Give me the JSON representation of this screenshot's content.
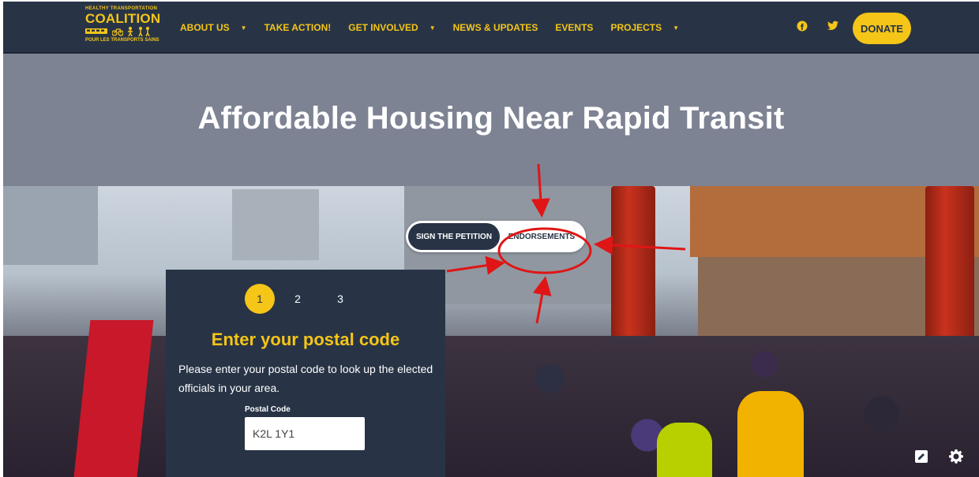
{
  "logo": {
    "line1": "HEALTHY TRANSPORTATION",
    "line2": "COALITION",
    "line4": "POUR LES TRANSPORTS SAINS"
  },
  "nav": {
    "items": [
      {
        "label": "ABOUT US",
        "has_dropdown": true
      },
      {
        "label": "TAKE ACTION!",
        "has_dropdown": false
      },
      {
        "label": "GET INVOLVED",
        "has_dropdown": true
      },
      {
        "label": "NEWS & UPDATES",
        "has_dropdown": false
      },
      {
        "label": "EVENTS",
        "has_dropdown": false
      },
      {
        "label": "PROJECTS",
        "has_dropdown": true
      }
    ],
    "facebook_glyph": "f",
    "twitter_glyph": "🐦",
    "donate_label": "DONATE"
  },
  "hero": {
    "title": "Affordable Housing Near Rapid Transit"
  },
  "tabs": {
    "active": "SIGN THE PETITION",
    "inactive": "ENDORSEMENTS"
  },
  "form": {
    "steps": [
      "1",
      "2",
      "3"
    ],
    "heading": "Enter your postal code",
    "description": "Please enter your postal code to look up the elected officials in your area.",
    "postal_label": "Postal Code",
    "postal_value": "K2L 1Y1"
  },
  "colors": {
    "navy": "#283446",
    "gold": "#f5c518",
    "hero_bg": "#7d8393",
    "annotation_red": "#e01515"
  },
  "icons": {
    "edit": "edit-icon",
    "settings": "gear-icon"
  }
}
